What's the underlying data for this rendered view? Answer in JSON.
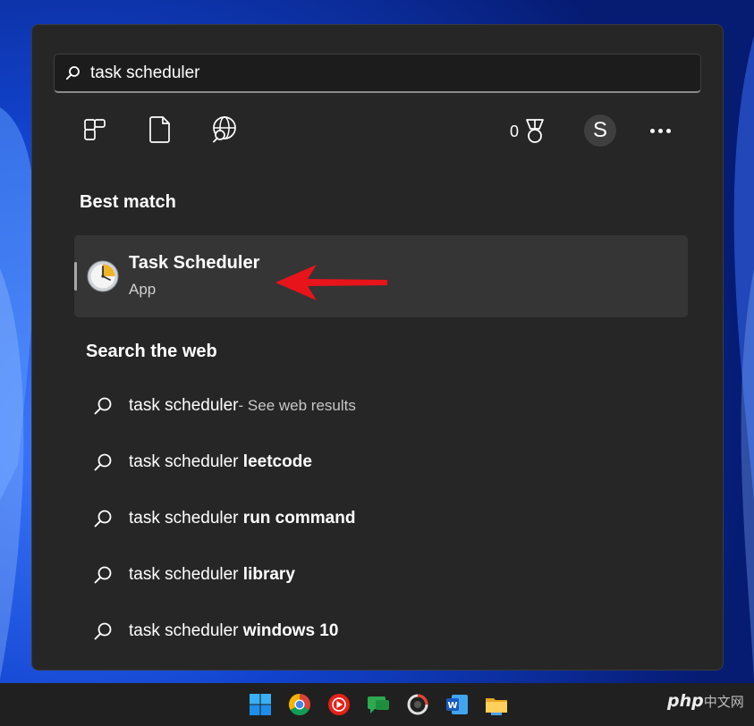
{
  "search": {
    "value": "task scheduler",
    "icon": "search-icon"
  },
  "filters": [
    {
      "name": "apps-filter-icon"
    },
    {
      "name": "documents-filter-icon"
    },
    {
      "name": "web-filter-icon"
    }
  ],
  "rewards": {
    "points": "0",
    "icon": "medal-icon"
  },
  "account": {
    "initial": "S"
  },
  "best_match": {
    "title": "Best match",
    "app_name": "Task Scheduler",
    "app_type": "App",
    "icon": "clock-icon"
  },
  "web": {
    "title": "Search the web",
    "items": [
      {
        "base": "task scheduler",
        "bold": "",
        "suffix": " - See web results"
      },
      {
        "base": "task scheduler ",
        "bold": "leetcode",
        "suffix": ""
      },
      {
        "base": "task scheduler ",
        "bold": "run command",
        "suffix": ""
      },
      {
        "base": "task scheduler ",
        "bold": "library",
        "suffix": ""
      },
      {
        "base": "task scheduler ",
        "bold": "windows 10",
        "suffix": ""
      }
    ]
  },
  "taskbar": {
    "icons": [
      "windows-start-icon",
      "chrome-icon",
      "youtube-music-icon",
      "messages-icon",
      "photo-editor-icon",
      "word-icon",
      "file-explorer-icon"
    ]
  },
  "watermark": {
    "brand": "php",
    "site": "中文网"
  },
  "colors": {
    "panel": "#262626",
    "card": "#353535",
    "arrow": "#e8141b",
    "accent": "#0078d4"
  }
}
